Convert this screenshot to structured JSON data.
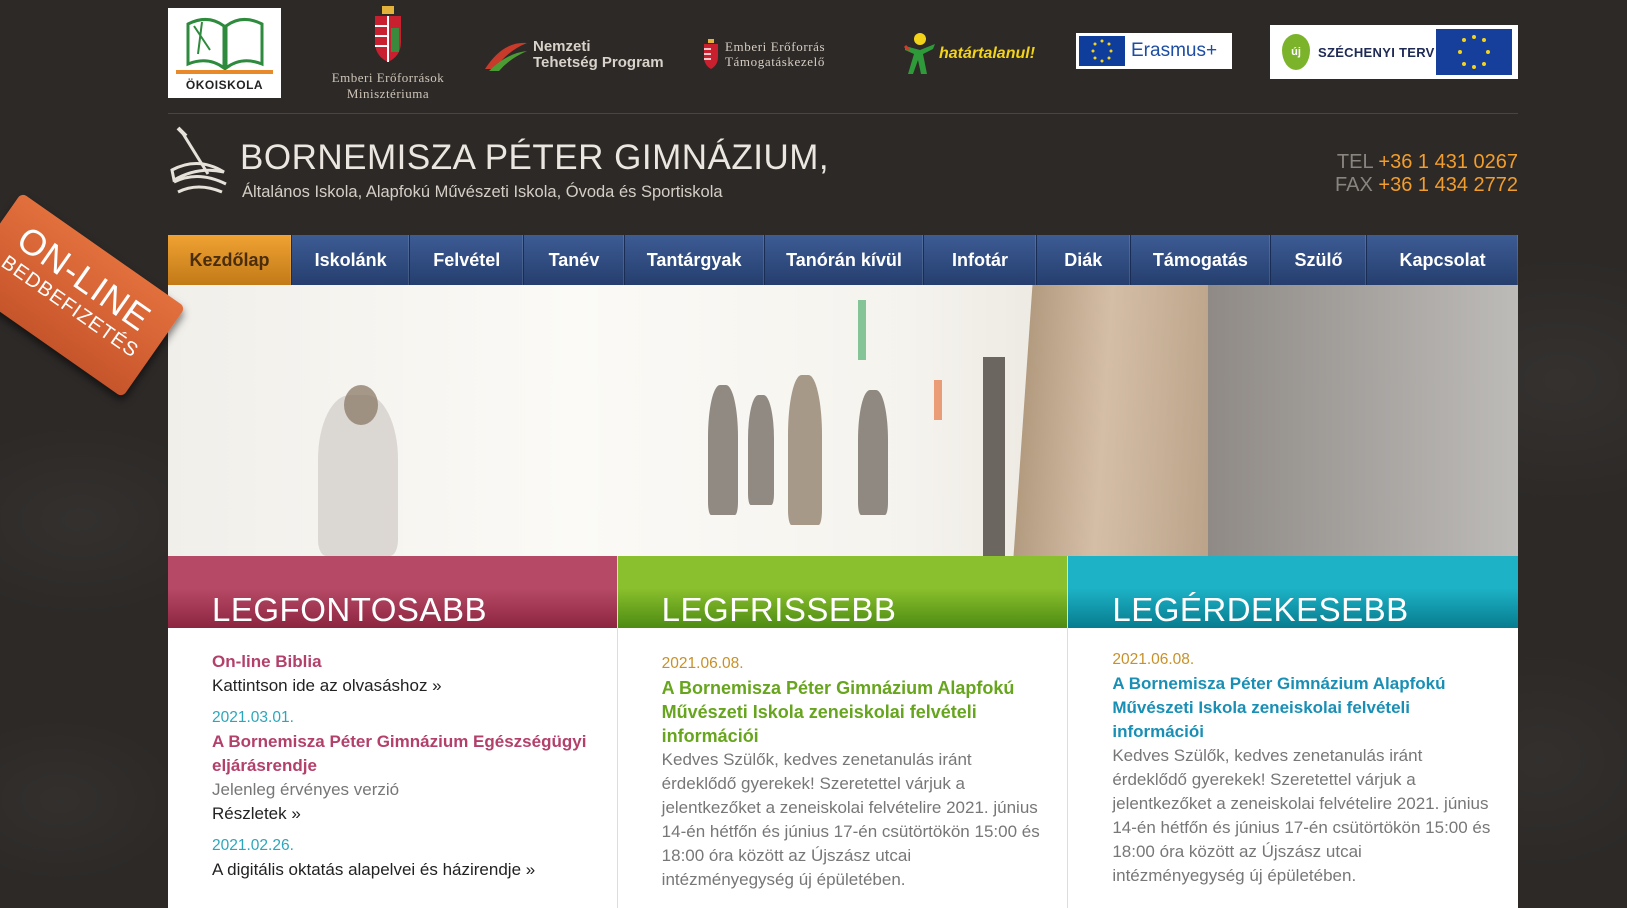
{
  "partners": {
    "okoiskola": "ÖKOISKOLA",
    "emmi": [
      "Emberi Erőforrások",
      "Minisztériuma"
    ],
    "ntp": [
      "Nemzeti",
      "Tehetség Program"
    ],
    "emet": [
      "Emberi Erőforrás",
      "Támogatáskezelő"
    ],
    "hatartalanul": "határtalanul!",
    "erasmus": "Erasmus+",
    "szechenyi": "SZÉCHENYI TERV",
    "szechenyi_badge": "új"
  },
  "header": {
    "name": "BORNEMISZA PÉTER GIMNÁZIUM,",
    "subtitle": "Általános Iskola, Alapfokú Művészeti Iskola, Óvoda és Sportiskola",
    "tel_label": "TEL",
    "tel": "+36 1 431 0267",
    "fax_label": "FAX",
    "fax": "+36 1 434 2772"
  },
  "nav": [
    "Kezdőlap",
    "Iskolánk",
    "Felvétel",
    "Tanév",
    "Tantárgyak",
    "Tanórán kívül",
    "Infotár",
    "Diák",
    "Támogatás",
    "Szülő",
    "Kapcsolat"
  ],
  "badge": {
    "line1": "ON-LINE",
    "line2": "BEDBEFIZETÉS"
  },
  "columns": {
    "c1": {
      "heading": "LEGFONTOSABB",
      "item1_title": "On-line Biblia",
      "item1_link": "Kattintson ide az olvasáshoz »",
      "item2_date": "2021.03.01.",
      "item2_title": "A Bornemisza Péter Gimnázium Egészségügyi eljárásrendje",
      "item2_text": "Jelenleg érvényes verzió",
      "item2_link": "Részletek »",
      "item3_date": "2021.02.26.",
      "item3_link": "A digitális oktatás alapelvei és házirendje »"
    },
    "c2": {
      "heading": "LEGFRISSEBB",
      "date": "2021.06.08.",
      "title": "A Bornemisza Péter Gimnázium Alapfokú Művészeti Iskola zeneiskolai felvételi információi",
      "text": "Kedves Szülők, kedves zenetanulás iránt érdeklődő gyerekek! Szeretettel várjuk a jelentkezőket a zeneiskolai felvételire 2021. június 14-én hétfőn és június 17-én csütörtökön 15:00 és 18:00 óra között az Újszász utcai intézményegység új épületében."
    },
    "c3": {
      "heading": "LEGÉRDEKESEBB",
      "date": "2021.06.08.",
      "title": "A Bornemisza Péter Gimnázium Alapfokú Művészeti Iskola zeneiskolai felvételi információi",
      "text": "Kedves Szülők, kedves zenetanulás iránt érdeklődő gyerekek! Szeretettel várjuk a jelentkezőket a zeneiskolai felvételire 2021. június 14-én hétfőn és június 17-én csütörtökön 15:00 és 18:00 óra között az Újszász utcai intézményegység új épületében."
    }
  }
}
